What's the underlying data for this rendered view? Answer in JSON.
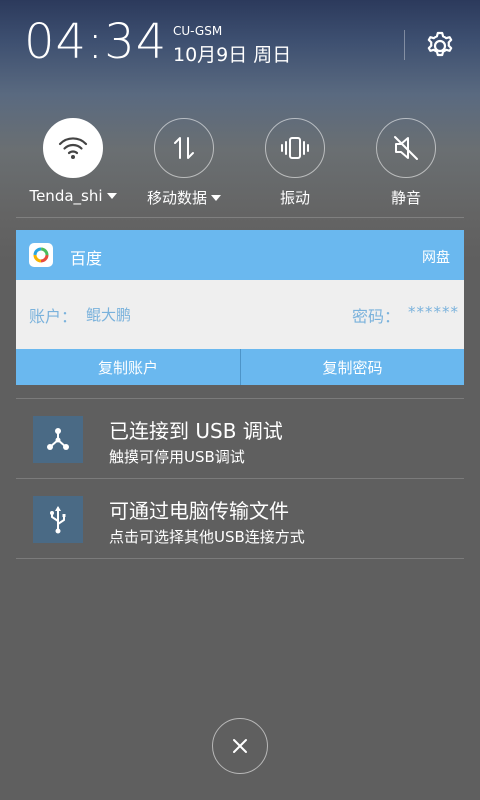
{
  "status": {
    "time": "04:34",
    "carrier": "CU-GSM",
    "date": "10月9日 周日"
  },
  "header": {
    "settings_icon": "gear-icon"
  },
  "quick_toggles": [
    {
      "label": "Tenda_shi",
      "icon": "wifi-icon",
      "active": true,
      "has_dropdown": true
    },
    {
      "label": "移动数据",
      "icon": "data-arrows-icon",
      "active": false,
      "has_dropdown": true
    },
    {
      "label": "振动",
      "icon": "vibrate-icon",
      "active": false,
      "has_dropdown": false
    },
    {
      "label": "静音",
      "icon": "mute-icon",
      "active": false,
      "has_dropdown": false
    }
  ],
  "password_card": {
    "app_name": "百度",
    "app_tag": "网盘",
    "account_label": "账户：",
    "account_value": "鲲大鹏",
    "password_label": "密码：",
    "password_value": "******",
    "copy_account_label": "复制账户",
    "copy_password_label": "复制密码",
    "accent_color": "#6ab8ef"
  },
  "notifications": [
    {
      "title": "已连接到 USB 调试",
      "subtitle": "触摸可停用USB调试",
      "icon": "usb-debug-icon"
    },
    {
      "title": "可通过电脑传输文件",
      "subtitle": "点击可选择其他USB连接方式",
      "icon": "usb-icon"
    }
  ],
  "close_icon": "close-icon"
}
